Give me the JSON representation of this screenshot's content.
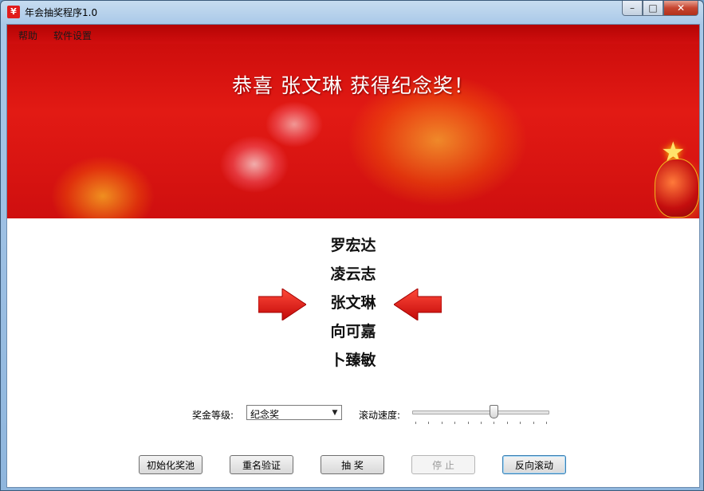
{
  "window": {
    "title": "年会抽奖程序1.0",
    "controls": {
      "minimize": "–",
      "maximize": "□",
      "close": "✕"
    }
  },
  "menu": {
    "items": [
      "帮助",
      "软件设置"
    ]
  },
  "banner": {
    "title": "恭喜  张文琳  获得纪念奖！"
  },
  "names": [
    "罗宏达",
    "凌云志",
    "张文琳",
    "向可嘉",
    "卜臻敏"
  ],
  "highlighted_index": 2,
  "controls": {
    "prize_level_label": "奖金等级:",
    "prize_level_value": "纪念奖",
    "scroll_speed_label": "滚动速度:",
    "scroll_speed_fraction": 0.6
  },
  "buttons": {
    "init_pool": "初始化奖池",
    "dup_check": "重名验证",
    "draw": "抽 奖",
    "stop": "停 止",
    "reverse": "反向滚动"
  },
  "colors": {
    "banner_red": "#e21a14",
    "arrow_red": "#e01010",
    "title_text": "#ffffff"
  },
  "icons": {
    "app": "red-envelope-icon",
    "pointer_left": "arrow-right-icon",
    "pointer_right": "arrow-left-icon"
  }
}
